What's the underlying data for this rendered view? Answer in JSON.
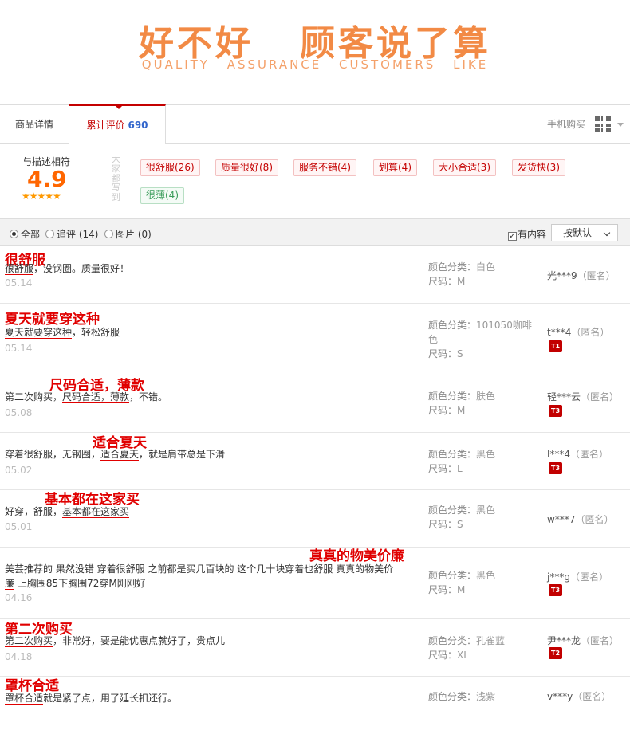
{
  "banner": {
    "title": "好不好   顾客说了算",
    "subtitle": "QUALITY ASSURANCE CUSTOMERS LIKE"
  },
  "tabs": {
    "details": "商品详情",
    "reviews": "累计评价",
    "review_count": "690",
    "mobile_buy": "手机购买"
  },
  "summary": {
    "label": "与描述相符",
    "score": "4.9",
    "stars": "★★★★★",
    "vertical_label": "大家都写到",
    "tags": [
      {
        "text": "很舒服(26)",
        "color": "red"
      },
      {
        "text": "质量很好(8)",
        "color": "red"
      },
      {
        "text": "服务不错(4)",
        "color": "red"
      },
      {
        "text": "划算(4)",
        "color": "red"
      },
      {
        "text": "大小合适(3)",
        "color": "red"
      },
      {
        "text": "发货快(3)",
        "color": "red"
      },
      {
        "text": "很薄(4)",
        "color": "green"
      }
    ]
  },
  "filter": {
    "all": "全部",
    "followup": "追评 (14)",
    "photos": "图片 (0)",
    "has_content": "有内容",
    "sort": "按默认"
  },
  "reviews": [
    {
      "headline": "很舒服",
      "pre": "",
      "hl": "很舒服",
      "post": "，没钢圈。质量很好！",
      "date": "05.14",
      "color_label": "颜色分类：",
      "color": "白色",
      "size_label": "尺码：",
      "size": "M",
      "user": "光***9",
      "anon": "（匿名）",
      "badge": ""
    },
    {
      "headline": "夏天就要穿这种",
      "pre": "",
      "hl": "夏天就要穿这种",
      "post": "，轻松舒服",
      "date": "05.14",
      "color_label": "颜色分类：",
      "color": "101050咖啡色",
      "size_label": "尺码：",
      "size": "S",
      "user": "t***4",
      "anon": "（匿名）",
      "badge": "T1"
    },
    {
      "headline": "尺码合适，薄款",
      "pre": "第二次购买，",
      "hl": "尺码合适，薄款",
      "post": "，不错。",
      "date": "05.08",
      "color_label": "颜色分类：",
      "color": "肤色",
      "size_label": "尺码：",
      "size": "M",
      "user": "轻***云",
      "anon": "（匿名）",
      "badge": "T3"
    },
    {
      "headline": "适合夏天",
      "pre": "穿着很舒服，无钢圈，",
      "hl": "适合夏天",
      "post": "，就是肩带总是下滑",
      "date": "05.02",
      "color_label": "颜色分类：",
      "color": "黑色",
      "size_label": "尺码：",
      "size": "L",
      "user": "l***4",
      "anon": "（匿名）",
      "badge": "T3"
    },
    {
      "headline": "基本都在这家买",
      "pre": "好穿，舒服，",
      "hl": "基本都在这家买",
      "post": "",
      "date": "05.01",
      "color_label": "颜色分类：",
      "color": "黑色",
      "size_label": "尺码：",
      "size": "S",
      "user": "w***7",
      "anon": "（匿名）",
      "badge": ""
    },
    {
      "headline": "真真的物美价廉",
      "pre": "美芸推荐的 果然没错 穿着很舒服 之前都是买几百块的 这个几十块穿着也舒服 ",
      "hl": "真真的物美价廉",
      "post": " 上胸围85下胸围72穿M刚刚好",
      "date": "04.16",
      "color_label": "颜色分类：",
      "color": "黑色",
      "size_label": "尺码：",
      "size": "M",
      "user": "j***g",
      "anon": "（匿名）",
      "badge": "T3"
    },
    {
      "headline": "第二次购买",
      "pre": "",
      "hl": "第二次购买",
      "post": "，非常好，要是能优惠点就好了，贵点儿",
      "date": "04.18",
      "color_label": "颜色分类：",
      "color": "孔雀蓝",
      "size_label": "尺码：",
      "size": "XL",
      "user": "尹***龙",
      "anon": "（匿名）",
      "badge": "T2"
    },
    {
      "headline": "罩杯合适",
      "pre": "",
      "hl": "罩杯合适",
      "post": "就是紧了点，用了延长扣还行。",
      "date": "",
      "color_label": "颜色分类：",
      "color": "浅紫",
      "size_label": "",
      "size": "",
      "user": "v***y",
      "anon": "（匿名）",
      "badge": ""
    }
  ]
}
